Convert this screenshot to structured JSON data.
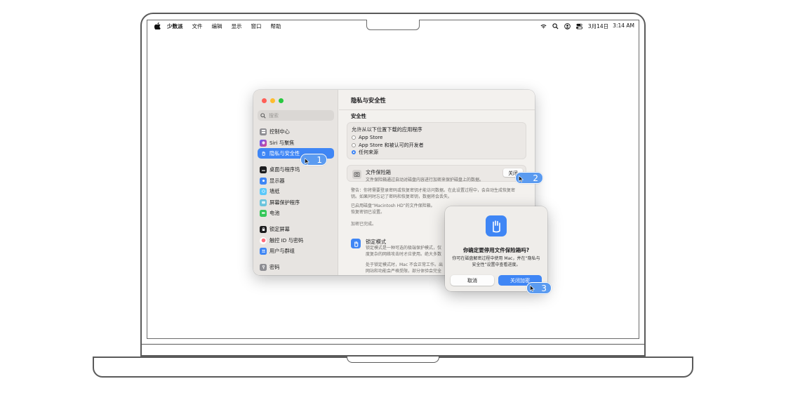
{
  "menubar": {
    "apple_icon": "apple-logo-icon",
    "app_name": "少数派",
    "menus": [
      "文件",
      "编辑",
      "显示",
      "窗口",
      "帮助"
    ],
    "status_icons": [
      "wifi-icon",
      "spotlight-search-icon",
      "user-icon",
      "control-center-icon"
    ],
    "date": "3月14日",
    "time": "3:14 AM"
  },
  "settings": {
    "search_placeholder": "搜索",
    "sidebar": [
      {
        "label": "控制中心",
        "icon": "control-center-icon",
        "color": "#8e8e93"
      },
      {
        "label": "Siri 与聚焦",
        "icon": "siri-icon",
        "color": "#3a3a3c"
      },
      {
        "label": "隐私与安全性",
        "icon": "hand-icon",
        "color": "#3f86f5",
        "active": true
      },
      {
        "label": "桌面与程序坞",
        "icon": "dock-icon",
        "color": "#1c1c1e"
      },
      {
        "label": "显示器",
        "icon": "display-icon",
        "color": "#3f86f5"
      },
      {
        "label": "墙纸",
        "icon": "wallpaper-icon",
        "color": "#5ac8fa"
      },
      {
        "label": "屏幕保护程序",
        "icon": "screensaver-icon",
        "color": "#6ac4dc"
      },
      {
        "label": "电池",
        "icon": "battery-icon",
        "color": "#34c759"
      },
      {
        "label": "锁定屏幕",
        "icon": "lock-screen-icon",
        "color": "#1c1c1e"
      },
      {
        "label": "触控 ID 与密码",
        "icon": "touch-id-icon",
        "color": "#ff6b7a"
      },
      {
        "label": "用户与群组",
        "icon": "users-icon",
        "color": "#3f86f5"
      },
      {
        "label": "密码",
        "icon": "key-icon",
        "color": "#8e8e93"
      }
    ],
    "title": "隐私与安全性",
    "section": "安全性",
    "download_title": "允许从以下位置下载的应用程序",
    "download_options": [
      "App Store",
      "App Store 和被认可的开发者",
      "任何来源"
    ],
    "download_selected": 2,
    "filevault": {
      "title": "文件保险箱",
      "desc": "文件保险箱通过自动对磁盘内容进行加密来保护磁盘上的数据。",
      "button": "关闭"
    },
    "warning_line1": "警告：你将需要登录密码或恢复密钥才能访问数据。在此设置过程中，会自动生成恢复密",
    "warning_line2": "钥。如果同时忘记了密码和恢复密钥，数据将会丢失。",
    "enabled_line1": "已启用磁盘“Macintosh HD”的文件保险箱。",
    "enabled_line2": "恢复密钥已设置。",
    "encryption_status": "加密已完成。",
    "lockdown": {
      "title": "锁定模式",
      "desc_line1": "锁定模式是一种可选的极端保护模式，仅",
      "desc_line2": "度复杂的网络攻击时才应使用。绝大多数",
      "desc_line3": "处于锁定模式时，Mac 不会正常工作。出",
      "desc_line4": "网站和功能会严格受限，部分体验会完全"
    }
  },
  "dialog": {
    "icon": "hand-icon",
    "title": "你确定要停用文件保险箱吗?",
    "message": "你可在磁盘解密过程中使用 Mac，并在“隐私与安全性”设置中查看进度。",
    "cancel": "取消",
    "confirm": "关闭加密"
  },
  "steps": [
    "1",
    "2",
    "3"
  ],
  "colors": {
    "accent": "#3f86f5",
    "badge": "#5b9bf0"
  }
}
